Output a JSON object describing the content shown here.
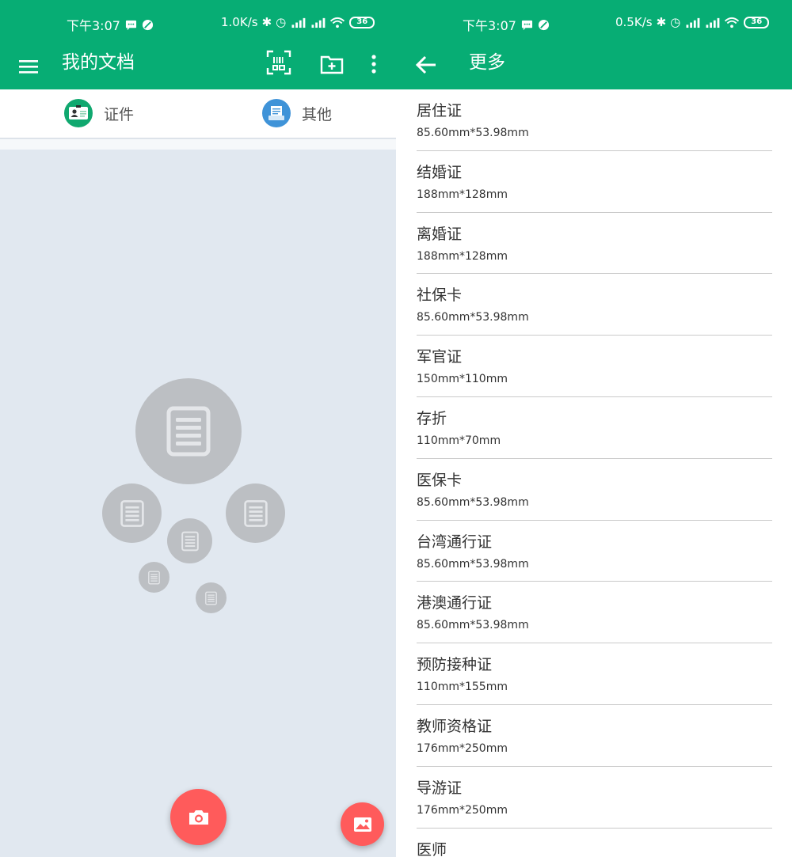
{
  "left_screen": {
    "status_bar": {
      "time": "下午3:07",
      "net_speed": "1.0K/s",
      "battery": "36"
    },
    "app_bar": {
      "menu_icon": "hamburger-menu-icon",
      "title": "我的文档",
      "scan_icon": "barcode-scan-icon",
      "add_folder_icon": "add-folder-icon",
      "more_icon": "more-vertical-icon"
    },
    "tabs": [
      {
        "label": "证件",
        "icon": "id-card-icon",
        "color": "#10a86f"
      },
      {
        "label": "其他",
        "icon": "document-scan-icon",
        "color": "#3f93d8"
      }
    ],
    "fab_camera_icon": "camera-icon",
    "fab_gallery_icon": "image-icon"
  },
  "right_screen": {
    "status_bar": {
      "time": "下午3:07",
      "net_speed": "0.5K/s",
      "battery": "36"
    },
    "app_bar": {
      "back_icon": "back-arrow-icon",
      "title": "更多"
    },
    "documents": [
      {
        "name": "居住证",
        "size": "85.60mm*53.98mm"
      },
      {
        "name": "结婚证",
        "size": "188mm*128mm"
      },
      {
        "name": "离婚证",
        "size": "188mm*128mm"
      },
      {
        "name": "社保卡",
        "size": "85.60mm*53.98mm"
      },
      {
        "name": "军官证",
        "size": "150mm*110mm"
      },
      {
        "name": "存折",
        "size": "110mm*70mm"
      },
      {
        "name": "医保卡",
        "size": "85.60mm*53.98mm"
      },
      {
        "name": "台湾通行证",
        "size": "85.60mm*53.98mm"
      },
      {
        "name": "港澳通行证",
        "size": "85.60mm*53.98mm"
      },
      {
        "name": "预防接种证",
        "size": "110mm*155mm"
      },
      {
        "name": "教师资格证",
        "size": "176mm*250mm"
      },
      {
        "name": "导游证",
        "size": "176mm*250mm"
      },
      {
        "name": "医师",
        "size": ""
      }
    ]
  },
  "colors": {
    "primary": "#07ad74",
    "fab": "#ff5b5b",
    "empty_background": "#e1e8f0",
    "bubble": "#bcbfc3"
  }
}
